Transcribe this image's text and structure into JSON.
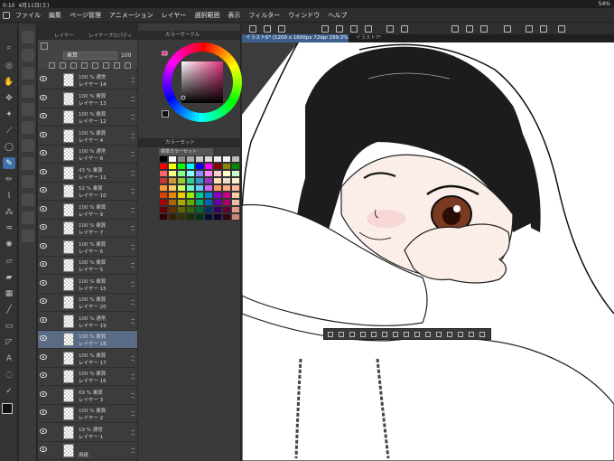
{
  "status": {
    "time": "0:10",
    "date": "4月11日(土)",
    "battery": "54%"
  },
  "menu": [
    "ファイル",
    "編集",
    "ページ管理",
    "アニメーション",
    "レイヤー",
    "選択範囲",
    "表示",
    "フィルター",
    "ウィンドウ",
    "ヘルプ"
  ],
  "layer_panel": {
    "tab_layer": "レイヤー",
    "tab_property": "レイヤープロパティ",
    "blend_mode": "乗算",
    "opacity": "100",
    "layers": [
      {
        "pct": "100 % 通常",
        "name": "レイヤー 14"
      },
      {
        "pct": "100 % 乗算",
        "name": "レイヤー 13"
      },
      {
        "pct": "100 % 乗算",
        "name": "レイヤー 12"
      },
      {
        "pct": "100 % 乗算",
        "name": "レイヤー 4"
      },
      {
        "pct": "100 % 通常",
        "name": "レイヤー 8"
      },
      {
        "pct": "43 % 乗算",
        "name": "レイヤー 11"
      },
      {
        "pct": "52 % 乗算",
        "name": "レイヤー 10"
      },
      {
        "pct": "100 % 乗算",
        "name": "レイヤー 9"
      },
      {
        "pct": "100 % 乗算",
        "name": "レイヤー 7"
      },
      {
        "pct": "100 % 乗算",
        "name": "レイヤー 6"
      },
      {
        "pct": "100 % 乗算",
        "name": "レイヤー 5"
      },
      {
        "pct": "100 % 乗算",
        "name": "レイヤー 15"
      },
      {
        "pct": "100 % 乗算",
        "name": "レイヤー 20"
      },
      {
        "pct": "100 % 通常",
        "name": "レイヤー 19"
      },
      {
        "pct": "100 % 乗算",
        "name": "レイヤー 18"
      },
      {
        "pct": "100 % 乗算",
        "name": "レイヤー 17"
      },
      {
        "pct": "100 % 乗算",
        "name": "レイヤー 16"
      },
      {
        "pct": "69 % 乗算",
        "name": "レイヤー 3"
      },
      {
        "pct": "100 % 乗算",
        "name": "レイヤー 2"
      },
      {
        "pct": "19 % 通常",
        "name": "レイヤー 1"
      },
      {
        "pct": "",
        "name": "用紙"
      }
    ],
    "selected_index": 14
  },
  "color_panel": {
    "wheel_title": "カラーサークル",
    "set_title": "カラーセット",
    "set_name": "標準カラーセット"
  },
  "canvas": {
    "tab_active": "イラスト6* (1200 x 1600px 72dpi 199.3%)",
    "tab_other": "イラスト7*"
  },
  "colors": {
    "accent": "#3e6fa8",
    "selected_layer": "#5a6b85"
  }
}
